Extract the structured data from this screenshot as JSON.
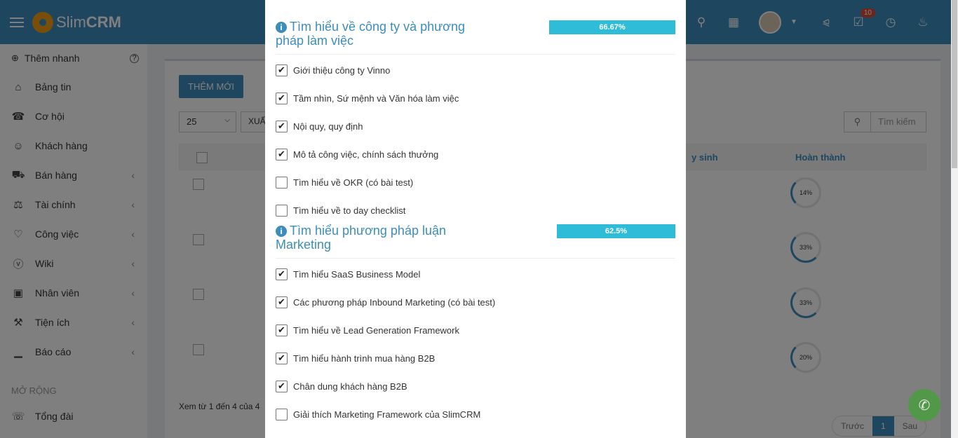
{
  "app": {
    "brand_light": "Slim",
    "brand_bold": "CRM",
    "notification_count": "10"
  },
  "sidebar": {
    "quick_add": "Thêm nhanh",
    "quick_help": "?",
    "items": [
      {
        "label": "Bảng tin",
        "icon": "home-icon",
        "arrow": false
      },
      {
        "label": "Cơ hội",
        "icon": "phone-wave-icon",
        "arrow": false
      },
      {
        "label": "Khách hàng",
        "icon": "user-icon",
        "arrow": false
      },
      {
        "label": "Bán hàng",
        "icon": "cart-icon",
        "arrow": true
      },
      {
        "label": "Tài chính",
        "icon": "balance-scale-icon",
        "arrow": true
      },
      {
        "label": "Công việc",
        "icon": "handshake-icon",
        "arrow": true
      },
      {
        "label": "Wiki",
        "icon": "vk-icon",
        "arrow": true
      },
      {
        "label": "Nhân viên",
        "icon": "id-badge-icon",
        "arrow": true
      },
      {
        "label": "Tiện ích",
        "icon": "wrench-icon",
        "arrow": true
      },
      {
        "label": "Báo cáo",
        "icon": "bar-chart-icon",
        "arrow": true
      }
    ],
    "section_label": "MỞ RỘNG",
    "extra_item": "Tổng đài"
  },
  "main": {
    "add_button": "THÊM MỚI",
    "page_size": "25",
    "export_button": "XUẤ",
    "search_placeholder": "Tìm kiếm",
    "col_date": "y sinh",
    "col_done": "Hoàn thành",
    "rings": [
      "14%",
      "33%",
      "33%",
      "20%"
    ],
    "info_text": "Xem từ 1 đến 4 của 4",
    "pager_prev": "Trước",
    "pager_page": "1",
    "pager_next": "Sau"
  },
  "modal": {
    "sections": [
      {
        "title": "Tìm hiểu về công ty và phương pháp làm việc",
        "progress_label": "66.67%",
        "progress": 0.6667,
        "tasks": [
          {
            "label": "Giới thiệu công ty Vinno",
            "checked": true
          },
          {
            "label": "Tầm nhìn, Sứ mệnh và Văn hóa làm việc",
            "checked": true
          },
          {
            "label": "Nội quy, quy định",
            "checked": true
          },
          {
            "label": "Mô tả công việc, chính sách thưởng",
            "checked": true
          },
          {
            "label": "Tìm hiểu về OKR (có bài test)",
            "checked": false
          },
          {
            "label": "Tìm hiểu về to day checklist",
            "checked": false
          }
        ]
      },
      {
        "title": "Tìm hiểu phương pháp luận Marketing",
        "progress_label": "62.5%",
        "progress": 0.625,
        "tasks": [
          {
            "label": "Tìm hiểu SaaS Business Model",
            "checked": true
          },
          {
            "label": "Các phương pháp Inbound Marketing (có bài test)",
            "checked": true
          },
          {
            "label": "Tìm hiểu về Lead Generation Framework",
            "checked": true
          },
          {
            "label": "Tìm hiểu hành trình mua hàng B2B",
            "checked": true
          },
          {
            "label": "Chân dung khách hàng B2B",
            "checked": true
          },
          {
            "label": "Giải thích Marketing Framework của SlimCRM",
            "checked": false
          }
        ]
      }
    ]
  },
  "colors": {
    "primary": "#3c8dbc",
    "progress": "#2fbcd9",
    "accent": "#f39c12",
    "badge": "#dd4b39"
  }
}
